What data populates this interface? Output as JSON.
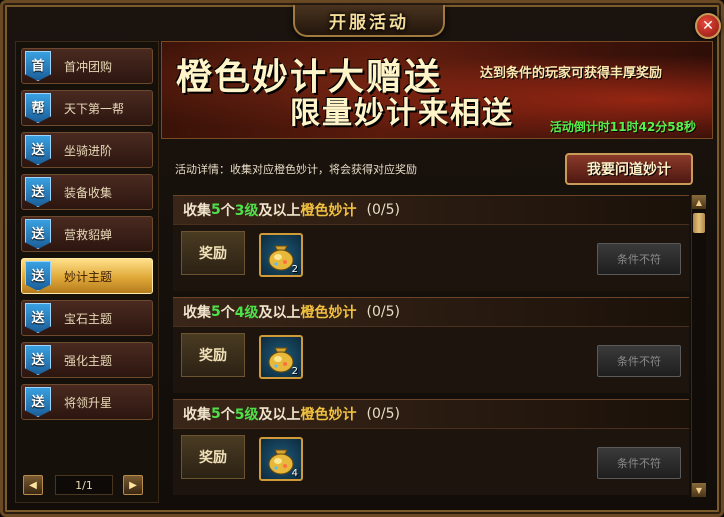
{
  "window": {
    "title": "开服活动",
    "close_symbol": "✕"
  },
  "sidebar": {
    "items": [
      {
        "badge": "首",
        "label": "首冲团购"
      },
      {
        "badge": "帮",
        "label": "天下第一帮"
      },
      {
        "badge": "送",
        "label": "坐骑进阶"
      },
      {
        "badge": "送",
        "label": "装备收集"
      },
      {
        "badge": "送",
        "label": "营救貂蝉"
      },
      {
        "badge": "送",
        "label": "妙计主题",
        "active": true
      },
      {
        "badge": "送",
        "label": "宝石主题"
      },
      {
        "badge": "送",
        "label": "强化主题"
      },
      {
        "badge": "送",
        "label": "将领升星"
      }
    ],
    "pager": {
      "text": "1/1",
      "prev_symbol": "◀",
      "next_symbol": "▶"
    }
  },
  "banner": {
    "line1": "橙色妙计大赠送",
    "subtitle": "达到条件的玩家可获得丰厚奖励",
    "line2": "限量妙计来相送",
    "countdown": "活动倒计时11时42分58秒"
  },
  "details": "活动详情：收集对应橙色妙计，将会获得对应奖励",
  "ask_button": "我要问道妙计",
  "entries": [
    {
      "prefix": "收集",
      "count": "5",
      "mid": "个",
      "level": "3级",
      "suffix": "及以上",
      "item_name": "橙色妙计",
      "progress": "(0/5)",
      "reward_label": "奖励",
      "reward_qty": "2",
      "status": "条件不符"
    },
    {
      "prefix": "收集",
      "count": "5",
      "mid": "个",
      "level": "4级",
      "suffix": "及以上",
      "item_name": "橙色妙计",
      "progress": "(0/5)",
      "reward_label": "奖励",
      "reward_qty": "2",
      "status": "条件不符"
    },
    {
      "prefix": "收集",
      "count": "5",
      "mid": "个",
      "level": "5级",
      "suffix": "及以上",
      "item_name": "橙色妙计",
      "progress": "(0/5)",
      "reward_label": "奖励",
      "reward_qty": "4",
      "status": "条件不符"
    }
  ],
  "scrollbar": {
    "up_symbol": "▲",
    "down_symbol": "▼"
  },
  "colors": {
    "highlight_green": "#4ee04a",
    "highlight_gold": "#f0c040",
    "countdown_green": "#59f04e"
  },
  "icons": {
    "reward_item": "gold-bag-icon"
  }
}
